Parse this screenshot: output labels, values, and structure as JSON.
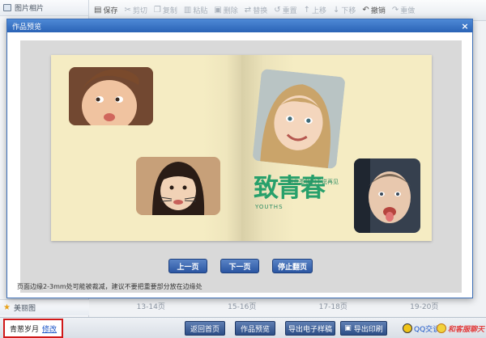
{
  "left_panel": {
    "header_label": "图片相片",
    "bottom_label": "美丽图"
  },
  "toolbar": {
    "items": [
      {
        "label": "保存",
        "icon": "save-icon",
        "enabled": true
      },
      {
        "label": "剪切",
        "icon": "cut-icon",
        "enabled": false
      },
      {
        "label": "复制",
        "icon": "copy-icon",
        "enabled": false
      },
      {
        "label": "粘贴",
        "icon": "paste-icon",
        "enabled": false
      },
      {
        "label": "删除",
        "icon": "delete-icon",
        "enabled": false
      },
      {
        "label": "替换",
        "icon": "replace-icon",
        "enabled": false
      },
      {
        "label": "重置",
        "icon": "reset-icon",
        "enabled": false
      },
      {
        "label": "上移",
        "icon": "up-icon",
        "enabled": false
      },
      {
        "label": "下移",
        "icon": "down-icon",
        "enabled": false
      },
      {
        "label": "撤销",
        "icon": "undo-icon",
        "enabled": true
      },
      {
        "label": "重做",
        "icon": "redo-icon",
        "enabled": false
      }
    ]
  },
  "background_pages": [
    "13-14页",
    "15-16页",
    "17-18页",
    "19-20页"
  ],
  "modal": {
    "title": "作品预览",
    "close_glyph": "×",
    "prev_label": "上一页",
    "next_label": "下一页",
    "stop_label": "停止翻页",
    "tip": "页面边缘2-3mm处可能被裁减，建议不要把重要部分放在边缘处"
  },
  "spread": {
    "headline_main": "致青春",
    "headline_sub": "毕业季我们不说再见",
    "headline_en": "YOUTHS"
  },
  "bottom_bar": {
    "project_name": "青葱岁月",
    "edit_label": "修改",
    "buttons": [
      "返回首页",
      "作品预览",
      "导出电子样稿",
      "导出印刷"
    ],
    "qq_label": "QQ交谈",
    "kf_label": "和客服聊天"
  },
  "colors": {
    "modal_title_bar": "#2a63b6",
    "button_blue": "#2b56a2",
    "highlight_red": "#d01818",
    "headline_green": "#27a06b",
    "page_cream": "#f5ecc3"
  }
}
